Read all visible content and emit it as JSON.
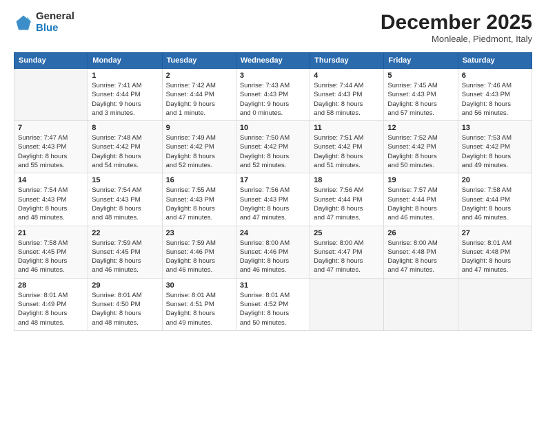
{
  "header": {
    "logo_line1": "General",
    "logo_line2": "Blue",
    "title": "December 2025",
    "subtitle": "Monleale, Piedmont, Italy"
  },
  "calendar": {
    "headers": [
      "Sunday",
      "Monday",
      "Tuesday",
      "Wednesday",
      "Thursday",
      "Friday",
      "Saturday"
    ],
    "weeks": [
      [
        {
          "day": "",
          "info": ""
        },
        {
          "day": "1",
          "info": "Sunrise: 7:41 AM\nSunset: 4:44 PM\nDaylight: 9 hours\nand 3 minutes."
        },
        {
          "day": "2",
          "info": "Sunrise: 7:42 AM\nSunset: 4:44 PM\nDaylight: 9 hours\nand 1 minute."
        },
        {
          "day": "3",
          "info": "Sunrise: 7:43 AM\nSunset: 4:43 PM\nDaylight: 9 hours\nand 0 minutes."
        },
        {
          "day": "4",
          "info": "Sunrise: 7:44 AM\nSunset: 4:43 PM\nDaylight: 8 hours\nand 58 minutes."
        },
        {
          "day": "5",
          "info": "Sunrise: 7:45 AM\nSunset: 4:43 PM\nDaylight: 8 hours\nand 57 minutes."
        },
        {
          "day": "6",
          "info": "Sunrise: 7:46 AM\nSunset: 4:43 PM\nDaylight: 8 hours\nand 56 minutes."
        }
      ],
      [
        {
          "day": "7",
          "info": "Sunrise: 7:47 AM\nSunset: 4:43 PM\nDaylight: 8 hours\nand 55 minutes."
        },
        {
          "day": "8",
          "info": "Sunrise: 7:48 AM\nSunset: 4:42 PM\nDaylight: 8 hours\nand 54 minutes."
        },
        {
          "day": "9",
          "info": "Sunrise: 7:49 AM\nSunset: 4:42 PM\nDaylight: 8 hours\nand 52 minutes."
        },
        {
          "day": "10",
          "info": "Sunrise: 7:50 AM\nSunset: 4:42 PM\nDaylight: 8 hours\nand 52 minutes."
        },
        {
          "day": "11",
          "info": "Sunrise: 7:51 AM\nSunset: 4:42 PM\nDaylight: 8 hours\nand 51 minutes."
        },
        {
          "day": "12",
          "info": "Sunrise: 7:52 AM\nSunset: 4:42 PM\nDaylight: 8 hours\nand 50 minutes."
        },
        {
          "day": "13",
          "info": "Sunrise: 7:53 AM\nSunset: 4:42 PM\nDaylight: 8 hours\nand 49 minutes."
        }
      ],
      [
        {
          "day": "14",
          "info": "Sunrise: 7:54 AM\nSunset: 4:43 PM\nDaylight: 8 hours\nand 48 minutes."
        },
        {
          "day": "15",
          "info": "Sunrise: 7:54 AM\nSunset: 4:43 PM\nDaylight: 8 hours\nand 48 minutes."
        },
        {
          "day": "16",
          "info": "Sunrise: 7:55 AM\nSunset: 4:43 PM\nDaylight: 8 hours\nand 47 minutes."
        },
        {
          "day": "17",
          "info": "Sunrise: 7:56 AM\nSunset: 4:43 PM\nDaylight: 8 hours\nand 47 minutes."
        },
        {
          "day": "18",
          "info": "Sunrise: 7:56 AM\nSunset: 4:44 PM\nDaylight: 8 hours\nand 47 minutes."
        },
        {
          "day": "19",
          "info": "Sunrise: 7:57 AM\nSunset: 4:44 PM\nDaylight: 8 hours\nand 46 minutes."
        },
        {
          "day": "20",
          "info": "Sunrise: 7:58 AM\nSunset: 4:44 PM\nDaylight: 8 hours\nand 46 minutes."
        }
      ],
      [
        {
          "day": "21",
          "info": "Sunrise: 7:58 AM\nSunset: 4:45 PM\nDaylight: 8 hours\nand 46 minutes."
        },
        {
          "day": "22",
          "info": "Sunrise: 7:59 AM\nSunset: 4:45 PM\nDaylight: 8 hours\nand 46 minutes."
        },
        {
          "day": "23",
          "info": "Sunrise: 7:59 AM\nSunset: 4:46 PM\nDaylight: 8 hours\nand 46 minutes."
        },
        {
          "day": "24",
          "info": "Sunrise: 8:00 AM\nSunset: 4:46 PM\nDaylight: 8 hours\nand 46 minutes."
        },
        {
          "day": "25",
          "info": "Sunrise: 8:00 AM\nSunset: 4:47 PM\nDaylight: 8 hours\nand 47 minutes."
        },
        {
          "day": "26",
          "info": "Sunrise: 8:00 AM\nSunset: 4:48 PM\nDaylight: 8 hours\nand 47 minutes."
        },
        {
          "day": "27",
          "info": "Sunrise: 8:01 AM\nSunset: 4:48 PM\nDaylight: 8 hours\nand 47 minutes."
        }
      ],
      [
        {
          "day": "28",
          "info": "Sunrise: 8:01 AM\nSunset: 4:49 PM\nDaylight: 8 hours\nand 48 minutes."
        },
        {
          "day": "29",
          "info": "Sunrise: 8:01 AM\nSunset: 4:50 PM\nDaylight: 8 hours\nand 48 minutes."
        },
        {
          "day": "30",
          "info": "Sunrise: 8:01 AM\nSunset: 4:51 PM\nDaylight: 8 hours\nand 49 minutes."
        },
        {
          "day": "31",
          "info": "Sunrise: 8:01 AM\nSunset: 4:52 PM\nDaylight: 8 hours\nand 50 minutes."
        },
        {
          "day": "",
          "info": ""
        },
        {
          "day": "",
          "info": ""
        },
        {
          "day": "",
          "info": ""
        }
      ]
    ]
  }
}
